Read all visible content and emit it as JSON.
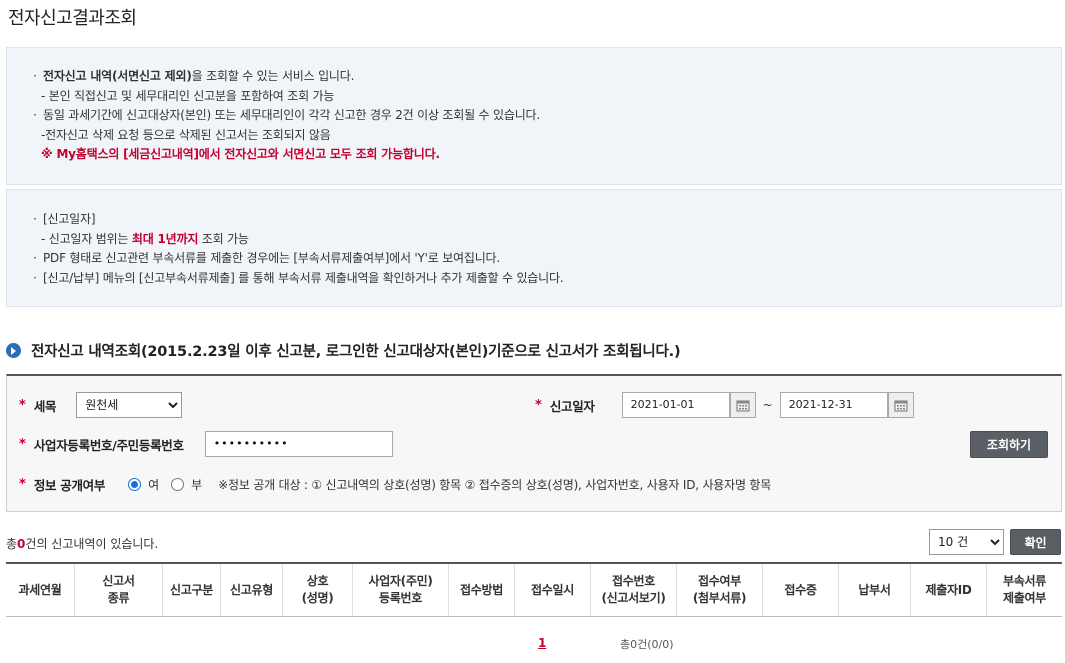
{
  "page": {
    "title": "전자신고결과조회"
  },
  "info1": {
    "line1_bold": "전자신고 내역(서면신고 제외)",
    "line1_rest": "을 조회할 수 있는 서비스 입니다.",
    "line2": "- 본인 직접신고 및 세무대리인 신고분을 포함하여 조회 가능",
    "line3": "동일 과세기간에 신고대상자(본인) 또는 세무대리인이 각각 신고한 경우 2건 이상 조회될 수 있습니다.",
    "line4": "-전자신고 삭제 요청 등으로 삭제된 신고서는 조회되지 않음",
    "line5": "※ My홈택스의 [세금신고내역]에서 전자신고와 서면신고 모두 조회 가능합니다."
  },
  "info2": {
    "line1": "[신고일자]",
    "line2_pre": "- 신고일자 범위는 ",
    "line2_red": "최대 1년까지",
    "line2_post": " 조회 가능",
    "line3": "PDF 형태로 신고관련 부속서류를 제출한 경우에는 [부속서류제출여부]에서 'Y'로 보여집니다.",
    "line4": "[신고/납부] 메뉴의 [신고부속서류제출] 를 통해 부속서류 제출내역을 확인하거나 추가 제출할 수 있습니다."
  },
  "section": {
    "title": "전자신고 내역조회(2015.2.23일 이후 신고분, 로그인한  신고대상자(본인)기준으로  신고서가 조회됩니다.)"
  },
  "search": {
    "required_mark": "*",
    "tax_label": "세목",
    "tax_value": "원천세",
    "date_label": "신고일자",
    "date_from": "2021-01-01",
    "date_to": "2021-12-31",
    "tilde": "~",
    "id_label": "사업자등록번호/주민등록번호",
    "id_value": "••••••••••",
    "search_button": "조회하기",
    "disclosure_label": "정보 공개여부",
    "opt_yes": "여",
    "opt_no": "부",
    "disclosure_note": "※정보 공개 대상 : ① 신고내역의 상호(성명) 항목 ② 접수증의 상호(성명), 사업자번호, 사용자 ID, 사용자명 항목"
  },
  "results": {
    "count_pre": "총",
    "count": "0",
    "count_post": "건의 신고내역이 있습니다.",
    "page_size": "10 건",
    "confirm_button": "확인"
  },
  "table": {
    "columns": [
      [
        "과세연월"
      ],
      [
        "신고서",
        "종류"
      ],
      [
        "신고구분"
      ],
      [
        "신고유형"
      ],
      [
        "상호",
        "(성명)"
      ],
      [
        "사업자(주민)",
        "등록번호"
      ],
      [
        "접수방법"
      ],
      [
        "접수일시"
      ],
      [
        "접수번호",
        "(신고서보기)"
      ],
      [
        "접수여부",
        "(첨부서류)"
      ],
      [
        "접수증"
      ],
      [
        "납부서"
      ],
      [
        "제출자ID"
      ],
      [
        "부속서류",
        "제출여부"
      ]
    ]
  },
  "pagination": {
    "current": "1",
    "total": "총0건(0/0)"
  }
}
